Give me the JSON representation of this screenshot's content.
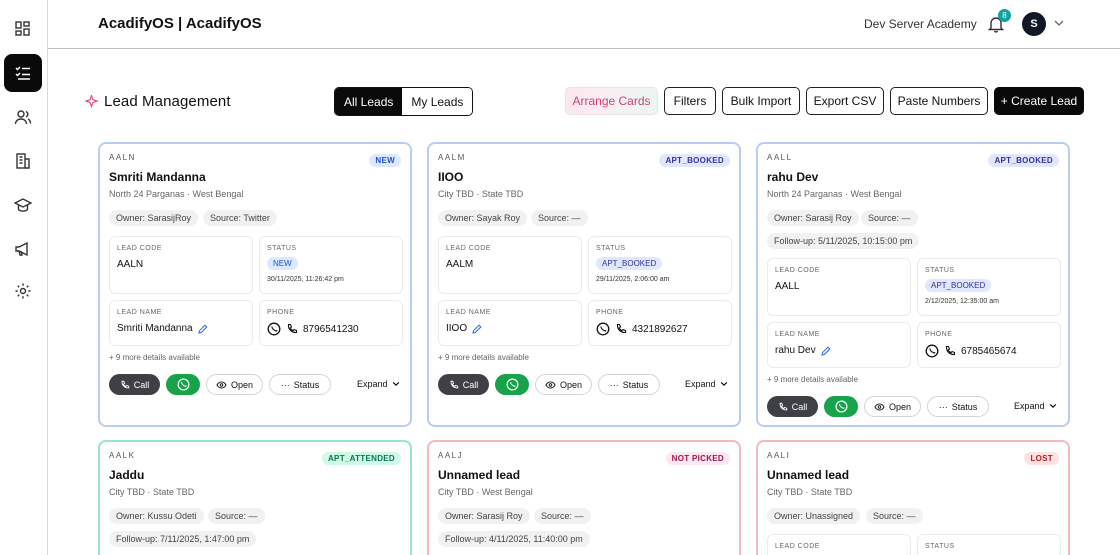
{
  "header": {
    "app_title": "AcadifyOS | AcadifyOS",
    "org_name": "Dev Server Academy",
    "notification_count": "8",
    "avatar_initial": "S"
  },
  "sidebar": {
    "items": [
      {
        "icon": "grid-icon",
        "active": false
      },
      {
        "icon": "list-check-icon",
        "active": true
      },
      {
        "icon": "users-icon",
        "active": false
      },
      {
        "icon": "building-icon",
        "active": false
      },
      {
        "icon": "graduation-cap-icon",
        "active": false
      },
      {
        "icon": "megaphone-icon",
        "active": false
      },
      {
        "icon": "gear-icon",
        "active": false
      }
    ]
  },
  "page": {
    "title": "Lead Management",
    "view_toggle": {
      "all": "All Leads",
      "mine": "My Leads",
      "selected": "all"
    },
    "toolbar": {
      "arrange": "Arrange Cards",
      "filters": "Filters",
      "bulk_import": "Bulk Import",
      "export_csv": "Export CSV",
      "paste_numbers": "Paste Numbers",
      "create_lead": "+ Create Lead"
    }
  },
  "labels": {
    "lead_code": "LEAD CODE",
    "status": "STATUS",
    "lead_name": "LEAD NAME",
    "phone": "PHONE",
    "more_details": "+ 9 more details available",
    "call": "Call",
    "open": "Open",
    "status_btn": "Status",
    "expand": "Expand"
  },
  "cards": [
    {
      "code": "AALN",
      "name": "Smriti Mandanna",
      "location": "North 24 Parganas · West Bengal",
      "status": "NEW",
      "owner": "Owner: SarasijRoy",
      "source": "Source: Twitter",
      "follow_up": "",
      "status_date": "30/11/2025, 11:26:42 pm",
      "phone": "8796541230"
    },
    {
      "code": "AALM",
      "name": "IIOO",
      "location": "City TBD · State TBD",
      "status": "APT_BOOKED",
      "owner": "Owner: Sayak Roy",
      "source": "Source: —",
      "follow_up": "",
      "status_date": "29/11/2025, 2:06:00 am",
      "phone": "4321892627"
    },
    {
      "code": "AALL",
      "name": "rahu Dev",
      "location": "North 24 Parganas · West Bengal",
      "status": "APT_BOOKED",
      "owner": "Owner: Sarasij Roy",
      "source": "Source: —",
      "follow_up": "Follow-up: 5/11/2025, 10:15:00 pm",
      "status_date": "2/12/2025, 12:35:00 am",
      "phone": "6785465674"
    },
    {
      "code": "AALK",
      "name": "Jaddu",
      "location": "City TBD · State TBD",
      "status": "APT_ATTENDED",
      "owner": "Owner: Kussu Odeti",
      "source": "Source: —",
      "follow_up": "Follow-up: 7/11/2025, 1:47:00 pm"
    },
    {
      "code": "AALJ",
      "name": "Unnamed lead",
      "location": "City TBD · West Bengal",
      "status": "NOT PICKED",
      "owner": "Owner: Sarasij Roy",
      "source": "Source: —",
      "follow_up": "Follow-up: 4/11/2025, 11:40:00 pm"
    },
    {
      "code": "AALI",
      "name": "Unnamed lead",
      "location": "City TBD · State TBD",
      "status": "LOST",
      "owner": "Owner: Unassigned",
      "source": "Source: —",
      "follow_up": ""
    }
  ],
  "colors": {
    "active_sidebar": "#0a0a0a",
    "card_border_blue": "#b9cdf3",
    "card_border_green": "#98e3d3",
    "card_border_red": "#f4b9bd",
    "whatsapp": "#16a34a",
    "badge": "#11a3a0"
  }
}
